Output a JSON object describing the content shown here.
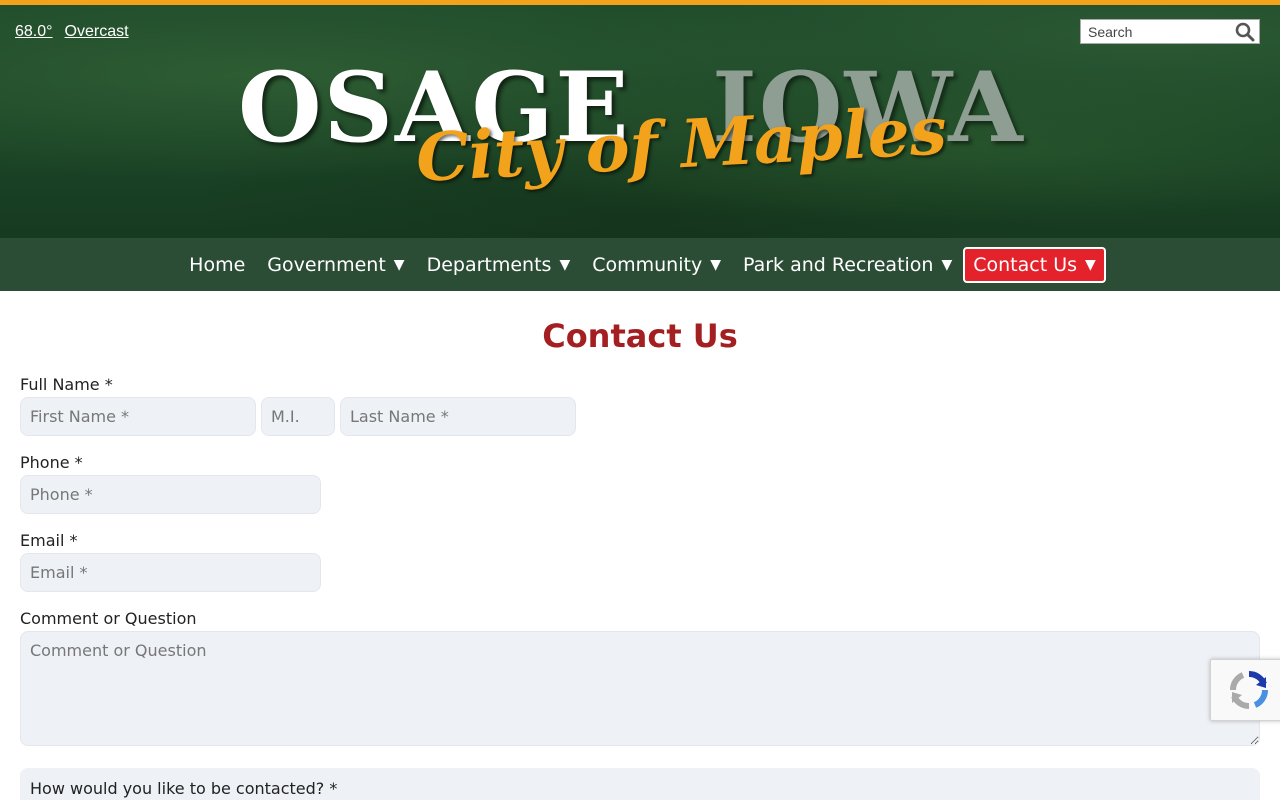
{
  "weather": {
    "temperature": "68.0°",
    "condition": "Overcast"
  },
  "search": {
    "placeholder": "Search"
  },
  "logo": {
    "word1": "OSAGE",
    "word2": "IOWA",
    "tagline": "City of Maples"
  },
  "nav": {
    "items": [
      {
        "label": "Home",
        "has_dropdown": false
      },
      {
        "label": "Government",
        "has_dropdown": true
      },
      {
        "label": "Departments",
        "has_dropdown": true
      },
      {
        "label": "Community",
        "has_dropdown": true
      },
      {
        "label": "Park and Recreation",
        "has_dropdown": true
      },
      {
        "label": "Contact Us",
        "has_dropdown": true,
        "active": true
      }
    ],
    "caret": "▼"
  },
  "page": {
    "title": "Contact Us"
  },
  "form": {
    "full_name_label": "Full Name *",
    "first_name_placeholder": "First Name *",
    "middle_initial_placeholder": "M.I.",
    "last_name_placeholder": "Last Name *",
    "phone_label": "Phone *",
    "phone_placeholder": "Phone *",
    "email_label": "Email *",
    "email_placeholder": "Email *",
    "comment_label": "Comment or Question",
    "comment_placeholder": "Comment or Question",
    "contact_method_label": "How would you like to be contacted? *"
  },
  "colors": {
    "accent_orange": "#f2a31b",
    "banner_green": "#1e4a2a",
    "nav_green": "#2c4d35",
    "active_red": "#e3222b",
    "title_red": "#a31f22"
  },
  "icons": {
    "search": "magnifier-icon",
    "recaptcha": "recaptcha-logo-icon"
  }
}
